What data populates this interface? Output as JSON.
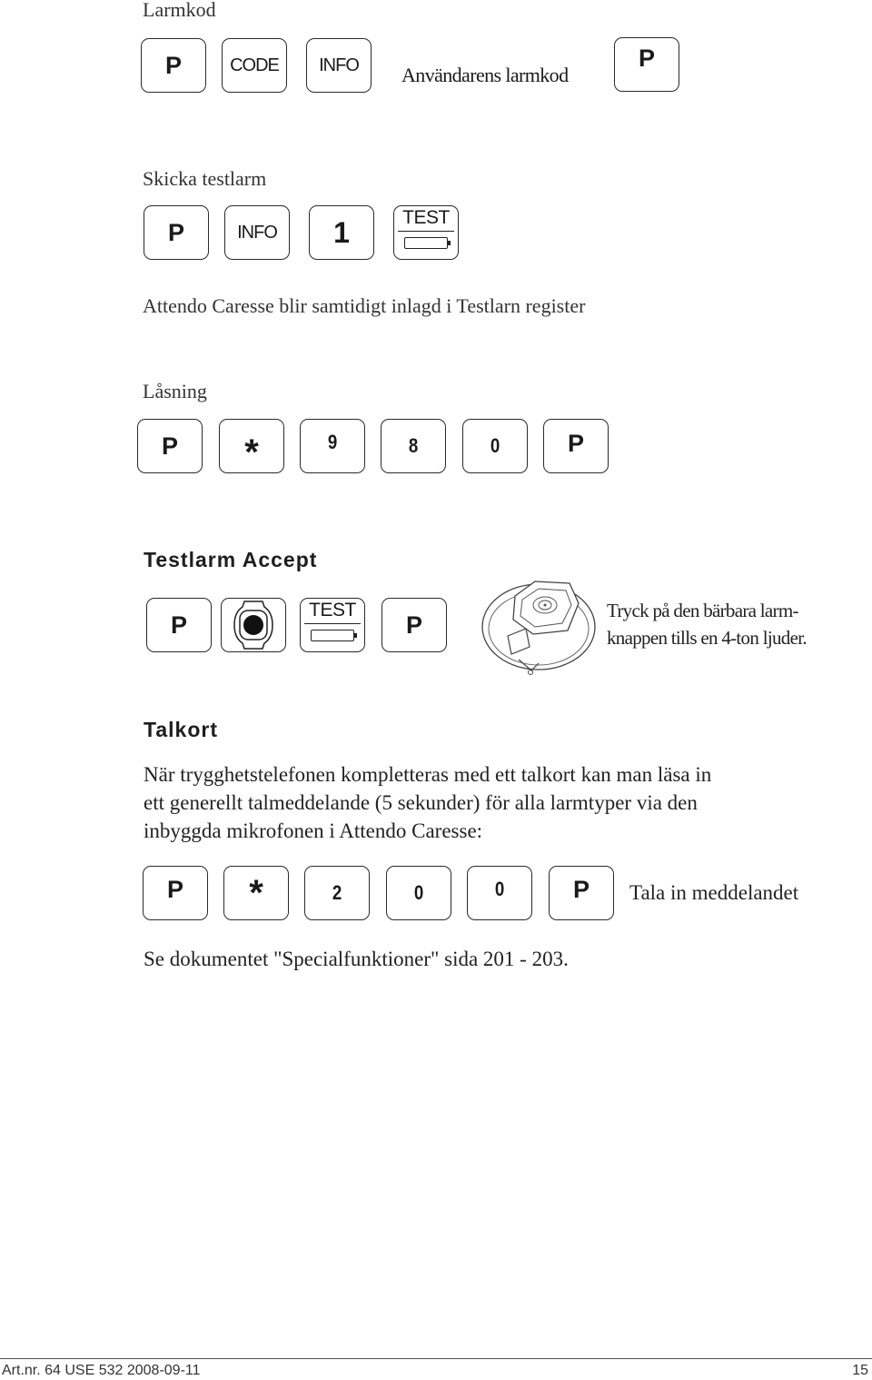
{
  "sections": {
    "larmkod": {
      "title": "Larmkod",
      "keys": [
        "P",
        "CODE",
        "INFO"
      ],
      "inline_text": "Användarens larmkod",
      "final_key": "P"
    },
    "skicka_testlarm": {
      "title": "Skicka testlarm",
      "keys": [
        "P",
        "INFO",
        "1",
        "TEST"
      ],
      "note": "Attendo Caresse blir samtidigt inlagd i Testlarn register"
    },
    "lasning": {
      "title": "Låsning",
      "keys": [
        "P",
        "*",
        "9",
        "8",
        "0",
        "P"
      ]
    },
    "testlarm_accept": {
      "title": "Testlarm Accept",
      "keys": [
        "P",
        "alarm-button",
        "TEST",
        "P"
      ],
      "instruction_line1": "Tryck på den bärbara larm-",
      "instruction_line2": "knappen tills en 4-ton ljuder."
    },
    "talkort": {
      "title": "Talkort",
      "paragraph_line1": "När trygghetstelefonen kompletteras med ett talkort kan man läsa in",
      "paragraph_line2": "ett generellt talmeddelande (5 sekunder) för alla larmtyper via den",
      "paragraph_line3": "inbyggda mikrofonen i Attendo Caresse:",
      "keys": [
        "P",
        "*",
        "2",
        "0",
        "0",
        "P"
      ],
      "inline_text": "Tala in meddelandet",
      "reference": "Se dokumentet \"Specialfunktioner\" sida 201 - 203."
    }
  },
  "footer": {
    "article": "Art.nr. 64 USE 532   2008-09-11",
    "page_number": "15"
  }
}
